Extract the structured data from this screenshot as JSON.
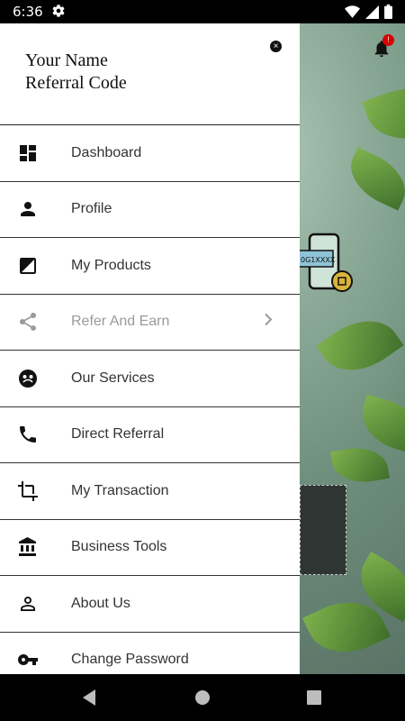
{
  "status_bar": {
    "time": "6:36",
    "icons": [
      "gear-icon",
      "wifi-icon",
      "signal-icon",
      "battery-icon"
    ]
  },
  "background": {
    "notification_count": "!",
    "code_sample": "0G1XXXX"
  },
  "drawer": {
    "user_name": "Your Name",
    "referral_code": "Referral Code",
    "close_icon": "close-icon",
    "items": [
      {
        "label": "Dashboard",
        "icon": "dashboard-icon"
      },
      {
        "label": "Profile",
        "icon": "person-icon"
      },
      {
        "label": "My Products",
        "icon": "image-icon"
      },
      {
        "label": "Refer And Earn",
        "icon": "share-icon",
        "expandable": true
      },
      {
        "label": "Our Services",
        "icon": "services-icon"
      },
      {
        "label": "Direct Referral",
        "icon": "phone-icon"
      },
      {
        "label": "My Transaction",
        "icon": "crop-icon"
      },
      {
        "label": "Business Tools",
        "icon": "bank-icon"
      },
      {
        "label": "About Us",
        "icon": "person-outline-icon"
      },
      {
        "label": "Change Password",
        "icon": "key-icon"
      }
    ]
  },
  "nav_bar": {
    "buttons": [
      "back-icon",
      "home-icon",
      "recents-icon"
    ]
  },
  "colors": {
    "drawer_bg": "#ffffff",
    "label_text": "#333333",
    "disabled_text": "#9a9a9a",
    "divider": "#333333",
    "badge": "#d60000"
  }
}
